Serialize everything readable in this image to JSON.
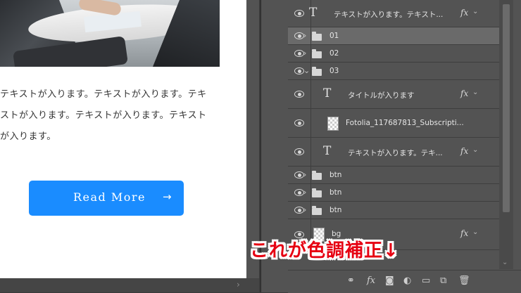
{
  "canvas": {
    "body_lines": [
      "テキストが入ります。テキストが入ります。テキ",
      "ストが入ります。テキストが入ります。テキスト",
      "が入ります。"
    ],
    "button_label": "Read More",
    "button_arrow": "→",
    "accent_color": "#1a8cff"
  },
  "layers": [
    {
      "kind": "text",
      "name": "テキストが入ります。テキスト...",
      "fx": "fx",
      "indent": 1
    },
    {
      "kind": "folder",
      "name": "01",
      "collapsed": true,
      "selected": true,
      "indent": 1
    },
    {
      "kind": "folder",
      "name": "02",
      "collapsed": true,
      "indent": 1
    },
    {
      "kind": "folder",
      "name": "03",
      "collapsed": false,
      "indent": 1
    },
    {
      "kind": "text",
      "name": "タイトルが入ります",
      "fx": "fx",
      "indent": 2
    },
    {
      "kind": "smart",
      "name": "Fotolia_117687813_Subscripti...",
      "indent": 2
    },
    {
      "kind": "text",
      "name": "テキストが入ります。テキ...",
      "fx": "fx",
      "indent": 2
    },
    {
      "kind": "folder",
      "name": "btn",
      "collapsed": true,
      "indent": 1
    },
    {
      "kind": "folder",
      "name": "btn",
      "collapsed": true,
      "indent": 1
    },
    {
      "kind": "folder",
      "name": "btn",
      "collapsed": true,
      "indent": 1
    },
    {
      "kind": "smart",
      "name": "bg",
      "fx": "fx",
      "indent": 1
    }
  ],
  "toolbar_icons": [
    "link-icon",
    "fx-icon",
    "mask-icon",
    "adjustment-icon",
    "folder-icon",
    "new-layer-icon",
    "trash-icon"
  ],
  "toolbar_fx": "fx",
  "annotation": {
    "text": "これが色調補正↓",
    "color": "#e60012"
  }
}
